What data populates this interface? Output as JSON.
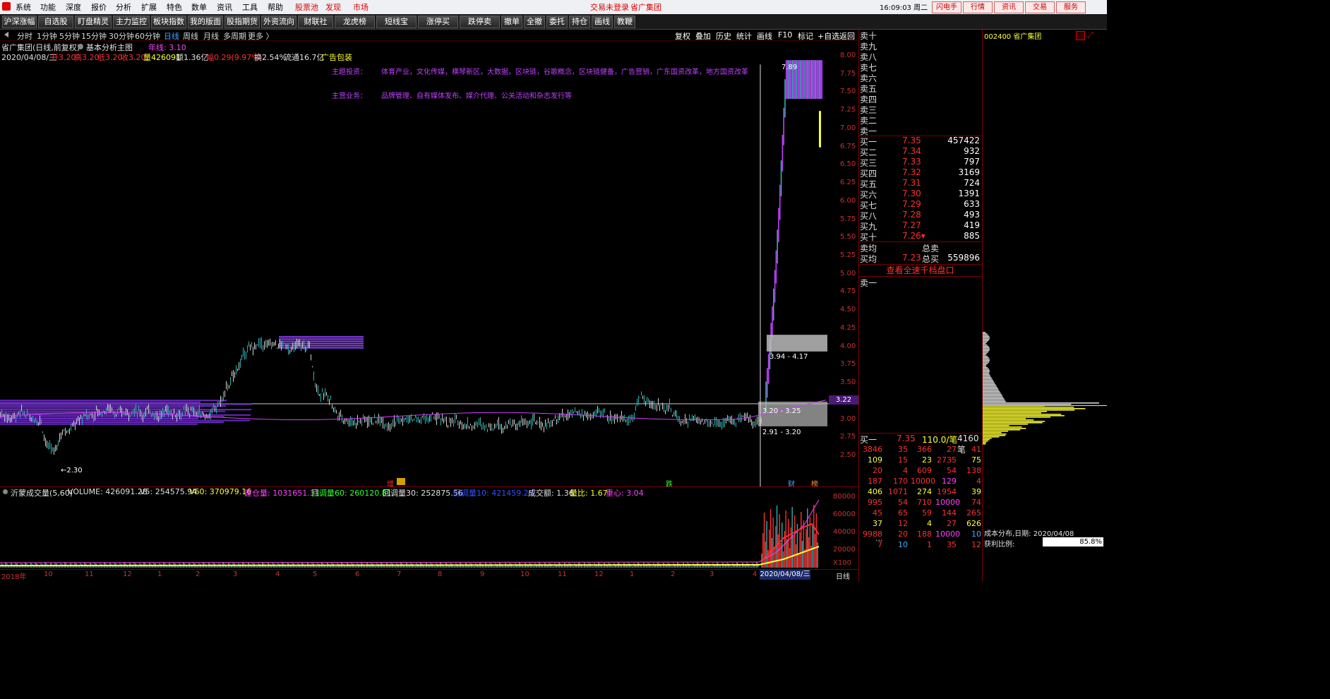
{
  "menu": {
    "items": [
      "系统",
      "功能",
      "深度",
      "报价",
      "分析",
      "扩展",
      "特色",
      "数单",
      "资讯",
      "工具",
      "帮助"
    ],
    "red_items": [
      "股票池",
      "发现",
      "市场"
    ],
    "login_status": "交易未登录",
    "stock_name": "省广集团",
    "time": "16:09:03 周二",
    "right_buttons": [
      "闪电手",
      "行情",
      "资讯",
      "交易",
      "服务"
    ]
  },
  "toolbar": {
    "buttons": [
      "沪深涨幅",
      "自选股",
      "盯盘精灵",
      "主力监控",
      "板块指数",
      "我的版面",
      "股指期货",
      "外资流向",
      "财联社",
      "龙虎榜",
      "短线宝",
      "涨停买",
      "跌停卖",
      "撤单",
      "全撤",
      "委托",
      "持仓",
      "画线",
      "教鞭"
    ]
  },
  "periods": {
    "items": [
      "分时",
      "1分钟",
      "5分钟",
      "15分钟",
      "30分钟",
      "60分钟",
      "日线",
      "周线",
      "月线",
      "多周期",
      "更多 〉"
    ],
    "active": "日线"
  },
  "chart_tools": [
    "复权",
    "叠加",
    "历史",
    "统计",
    "画线",
    "F10",
    "标记",
    "+自选",
    "返回"
  ],
  "stock_info": {
    "title": "省广集团(日线,前复权)",
    "indicator": "基本分析主图",
    "year_line": "年线: 3.10",
    "date": "2020/04/08/三",
    "open": "开3.20",
    "high": "高3.20",
    "low": "低3.20",
    "close": "收3.20",
    "volume": "量426091",
    "amount": "额1.36亿",
    "change": "幅0.29(9.97%)",
    "turnover": "换2.54%",
    "float_cap": "流通16.7亿",
    "sector": "广告包装"
  },
  "themes": {
    "label": "主题投资：",
    "text": "体育产业，文化传媒，横琴新区，大数据，区块链，谷歌概念，区块链健备，广告营销，广东国资改革，地方国资改革",
    "biz_label": "主营业务：",
    "biz_text": "品牌管理、自有媒体发布、媒介代理、公关活动和杂志发行等"
  },
  "chart_annotations": {
    "high_label": "7.89",
    "low_label": "←2.30",
    "range_upper": "3.94 - 4.17",
    "range_mid": "3.20 - 3.25",
    "range_lower": "2.91 - 3.20",
    "current_price": "3.22",
    "markers": [
      "增",
      "跌",
      "财",
      "榜"
    ]
  },
  "y_axis_labels": [
    "8.00",
    "7.75",
    "7.50",
    "7.25",
    "7.00",
    "6.75",
    "6.50",
    "6.25",
    "6.00",
    "5.75",
    "5.50",
    "5.25",
    "5.00",
    "4.75",
    "4.50",
    "4.25",
    "4.00",
    "3.75",
    "3.50",
    "3.25",
    "3.00",
    "2.75",
    "2.50"
  ],
  "x_axis_labels": [
    "2018年",
    "10",
    "11",
    "12",
    "1",
    "2",
    "3",
    "4",
    "5",
    "6",
    "7",
    "8",
    "9",
    "10",
    "11",
    "12",
    "1",
    "2",
    "3",
    "4"
  ],
  "x_axis_date": "2020/04/08/三",
  "x_axis_period": "日线",
  "volume_panel": {
    "name": "沂蒙成交量(5,60)",
    "volume": "VOLUME: 426091.28",
    "v5": "V5: 254575.94",
    "v60": "V60: 370979.16",
    "jc": "建仓量: 1031651.31",
    "hd60": "回调量60: 260120.81",
    "hd30": "回调量30: 252875.56",
    "hd10": "回调量10: 421459.25",
    "amt": "成交额: 1.36",
    "ratio": "量比: 1.67",
    "center": "重心: 3.04",
    "axis": [
      "80000",
      "60000",
      "40000",
      "20000",
      "X100"
    ]
  },
  "right_panel": {
    "code_name": "002400 省广集团",
    "sell_labels": [
      "卖十",
      "卖九",
      "卖八",
      "卖七",
      "卖六",
      "卖五",
      "卖四",
      "卖三",
      "卖二",
      "卖一"
    ],
    "buy_levels": [
      {
        "label": "买一",
        "price": "7.35",
        "vol": "457422"
      },
      {
        "label": "买二",
        "price": "7.34",
        "vol": "932"
      },
      {
        "label": "买三",
        "price": "7.33",
        "vol": "797"
      },
      {
        "label": "买四",
        "price": "7.32",
        "vol": "3169"
      },
      {
        "label": "买五",
        "price": "7.31",
        "vol": "724"
      },
      {
        "label": "买六",
        "price": "7.30",
        "vol": "1391"
      },
      {
        "label": "买七",
        "price": "7.29",
        "vol": "633"
      },
      {
        "label": "买八",
        "price": "7.28",
        "vol": "493"
      },
      {
        "label": "买九",
        "price": "7.27",
        "vol": "419"
      },
      {
        "label": "买十",
        "price": "7.26▾",
        "vol": "885"
      }
    ],
    "sell_avg_label": "卖均",
    "total_sell_label": "总卖",
    "buy_avg_label": "买均",
    "buy_avg": "7.23",
    "total_buy_label": "总买",
    "total_buy": "559896",
    "view_full": "查看全速千档盘口",
    "sell_one": "卖一",
    "buy_one_label": "买一",
    "buy_one_price": "7.35",
    "buy_one_per": "110.0/笔",
    "buy_one_count": "4160笔",
    "ticks": [
      [
        "3846",
        "35",
        "366",
        "27",
        "41"
      ],
      [
        "109",
        "15",
        "23",
        "2735",
        "75"
      ],
      [
        "20",
        "4",
        "609",
        "54",
        "138"
      ],
      [
        "187",
        "170",
        "10000",
        "129",
        "4"
      ],
      [
        "406",
        "1071",
        "274",
        "1954",
        "39"
      ],
      [
        "995",
        "54",
        "710",
        "10000",
        "74"
      ],
      [
        "45",
        "65",
        "59",
        "144",
        "265"
      ],
      [
        "37",
        "12",
        "4",
        "27",
        "626"
      ],
      [
        "9988",
        "20",
        "188",
        "10000",
        "10"
      ],
      [
        "7",
        "10",
        "1",
        "35",
        "12"
      ]
    ],
    "ellipsis": "...",
    "cost_title": "成本分布,日期: 2020/04/08",
    "profit_label": "获利比例:",
    "profit_value": "85.8%"
  },
  "colors": {
    "red": "#ff3030",
    "purple": "#c040ff",
    "yellow": "#ffff30"
  }
}
